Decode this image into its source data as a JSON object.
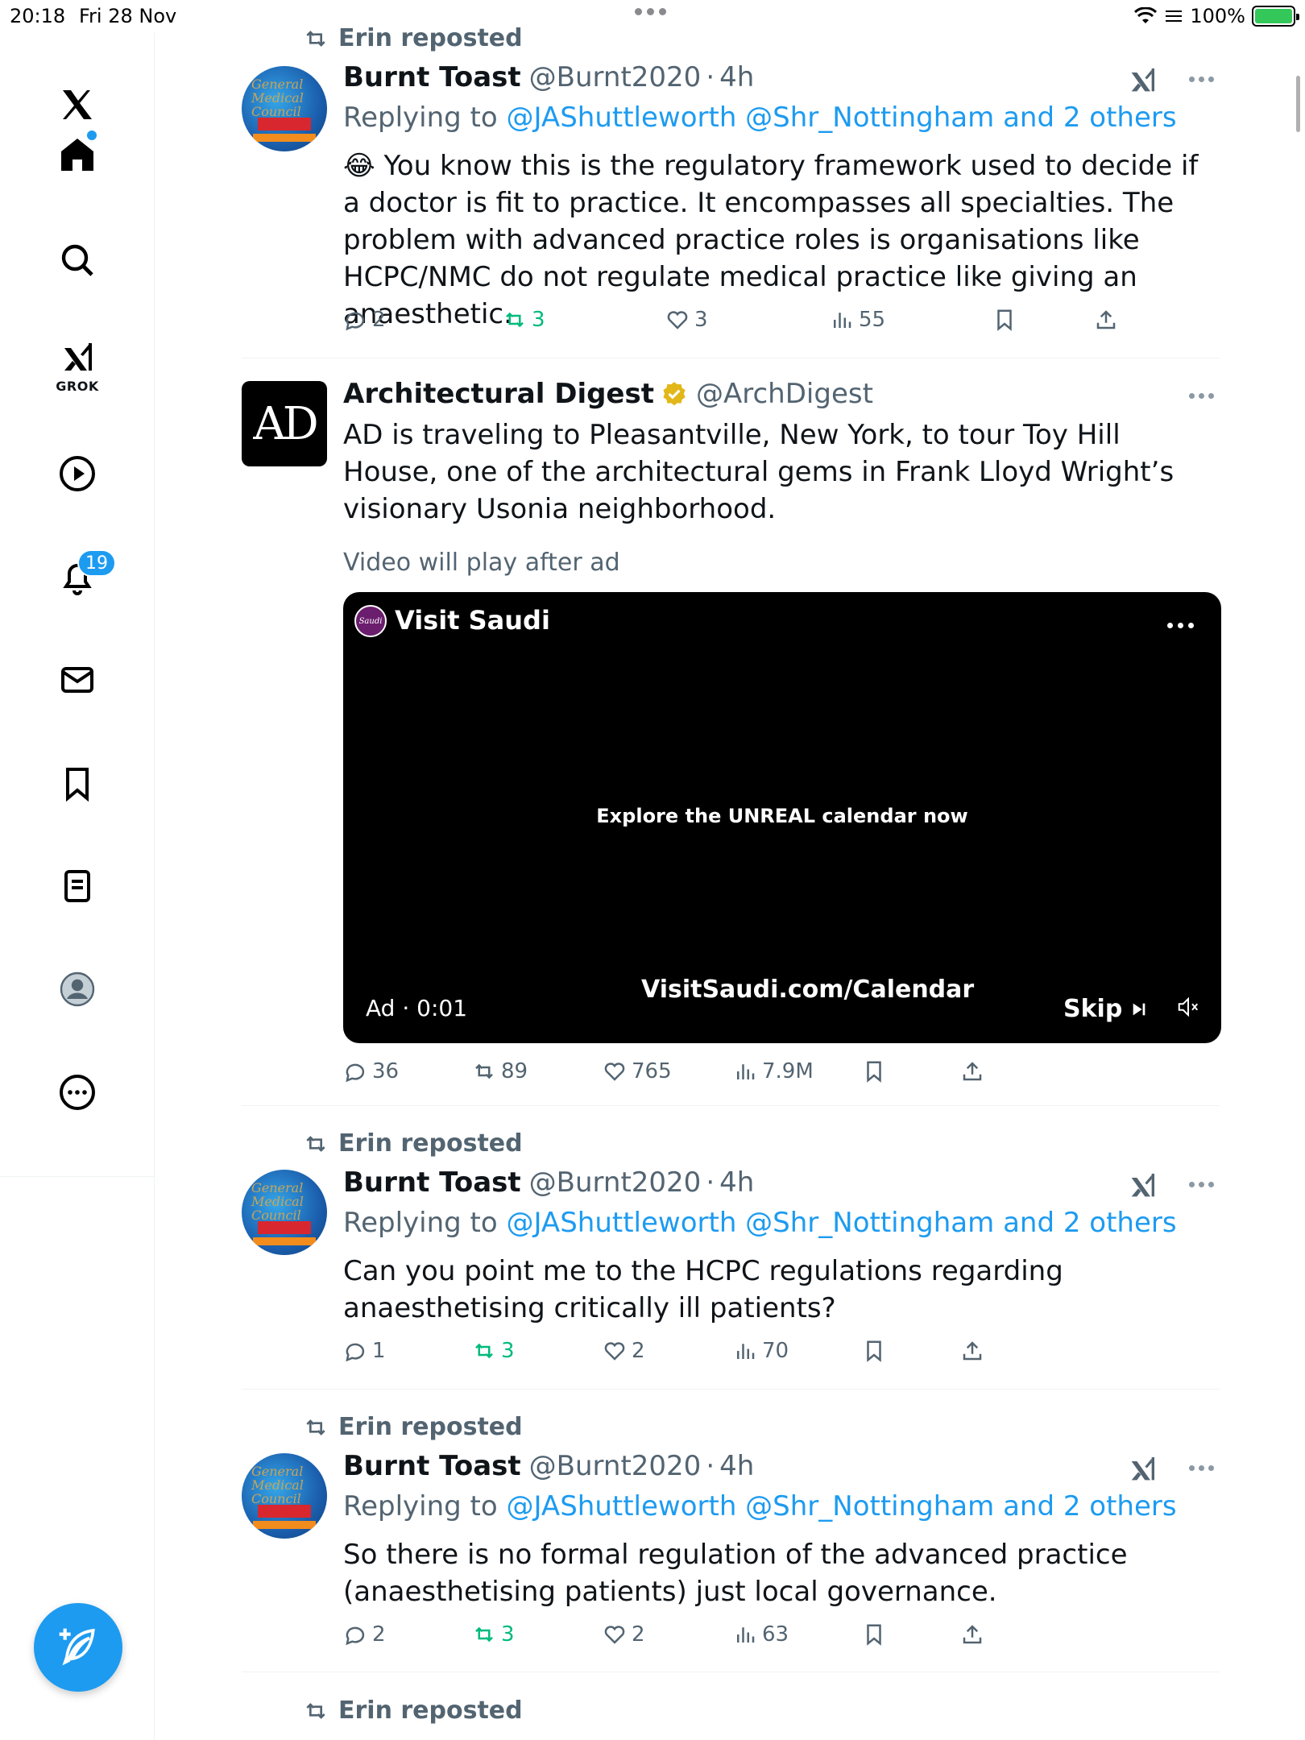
{
  "status_bar": {
    "time": "20:18",
    "date": "Fri 28 Nov",
    "battery": "100%"
  },
  "sidebar": {
    "items": [
      {
        "name": "logo",
        "label": ""
      },
      {
        "name": "home",
        "label": ""
      },
      {
        "name": "search",
        "label": ""
      },
      {
        "name": "grok",
        "label": "GROK"
      },
      {
        "name": "video",
        "label": ""
      },
      {
        "name": "notifications",
        "label": "",
        "badge": "19"
      },
      {
        "name": "messages",
        "label": ""
      },
      {
        "name": "bookmarks",
        "label": ""
      },
      {
        "name": "lists",
        "label": ""
      },
      {
        "name": "profile",
        "label": ""
      },
      {
        "name": "more",
        "label": ""
      }
    ]
  },
  "tweets": [
    {
      "repost": "Erin reposted",
      "name": "Burnt Toast",
      "handle": "@Burnt2020",
      "dot": "·",
      "time": "4h",
      "reply_prefix": "Replying to",
      "reply_links": "@JAShuttleworth @Shr_Nottingham and 2 others",
      "text": "😂 You know this is the regulatory framework used to decide if a doctor is fit to practice. It encompasses all specialties. The problem with advanced practice roles is organisations like HCPC/NMC do not regulate medical practice like giving an anaesthetic.",
      "replies": "2",
      "reposts": "3",
      "likes": "3",
      "views": "55"
    },
    {
      "name": "Architectural Digest",
      "handle": "@ArchDigest",
      "avatar_text": "AD",
      "text": "AD is traveling to Pleasantville, New York, to tour Toy Hill House, one of the architectural gems in Frank Lloyd Wright’s visionary Usonia neighborhood.",
      "ad_notice": "Video will play after ad",
      "video": {
        "logo_text": "Saudi",
        "title": "Visit Saudi",
        "center_text": "Explore the UNREAL calendar now",
        "url": "VisitSaudi.com/Calendar",
        "ad_time": "Ad · 0:01",
        "skip": "Skip"
      },
      "replies": "36",
      "reposts": "89",
      "likes": "765",
      "views": "7.9M"
    },
    {
      "repost": "Erin reposted",
      "name": "Burnt Toast",
      "handle": "@Burnt2020",
      "dot": "·",
      "time": "4h",
      "reply_prefix": "Replying to",
      "reply_links": "@JAShuttleworth @Shr_Nottingham and 2 others",
      "text": "Can you point me to the HCPC regulations regarding anaesthetising critically ill patients?",
      "replies": "1",
      "reposts": "3",
      "likes": "2",
      "views": "70"
    },
    {
      "repost": "Erin reposted",
      "name": "Burnt Toast",
      "handle": "@Burnt2020",
      "dot": "·",
      "time": "4h",
      "reply_prefix": "Replying to",
      "reply_links": "@JAShuttleworth @Shr_Nottingham and 2 others",
      "text": "So there is no formal regulation of the advanced practice (anaesthetising patients) just local governance.",
      "replies": "2",
      "reposts": "3",
      "likes": "2",
      "views": "63"
    },
    {
      "repost": "Erin reposted"
    }
  ],
  "avatar_gmc_text": "General Medical Council",
  "colors": {
    "accent": "#1d9bf0",
    "repost_green": "#00ba7c",
    "muted": "#536471"
  }
}
